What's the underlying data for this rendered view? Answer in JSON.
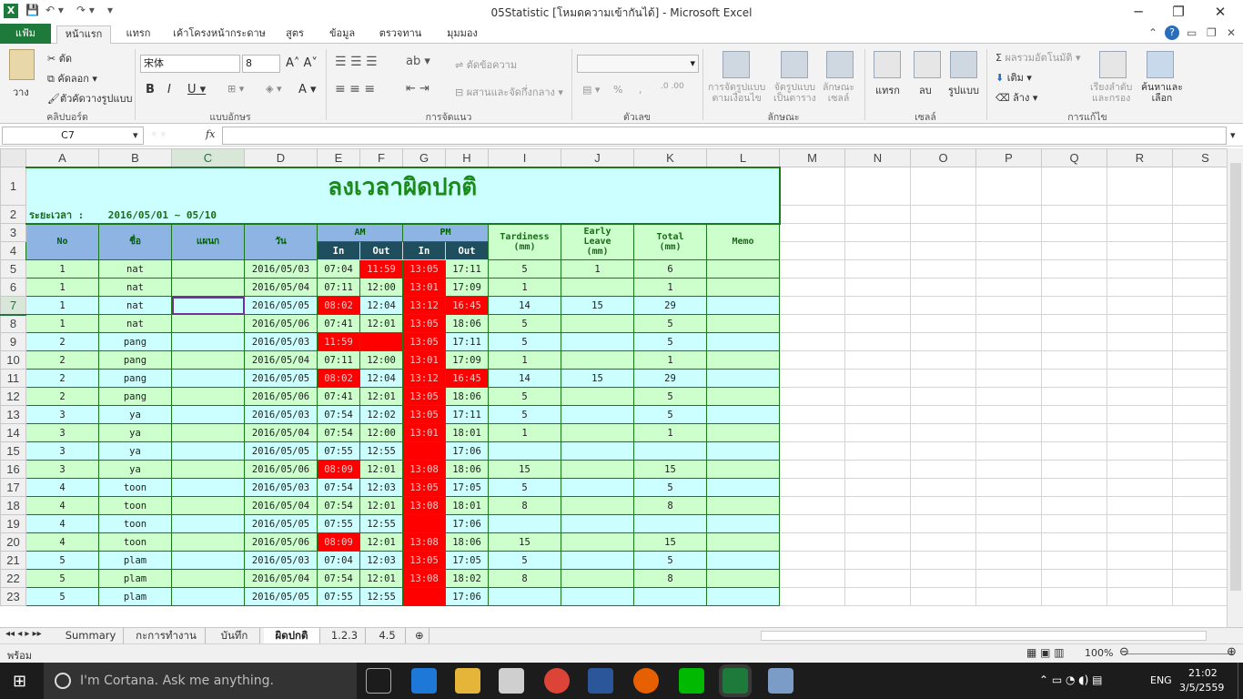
{
  "window": {
    "title": "05Statistic  [โหมดความเข้ากันได้] - Microsoft Excel"
  },
  "ribbon_tabs": [
    "แฟ้ม",
    "หน้าแรก",
    "แทรก",
    "เค้าโครงหน้ากระดาษ",
    "สูตร",
    "ข้อมูล",
    "ตรวจทาน",
    "มุมมอง"
  ],
  "ribbon": {
    "clipboard": {
      "cut": "ตัด",
      "copy": "คัดลอก",
      "paste": "วาง",
      "format_painter": "ตัวคัดวางรูปแบบ",
      "label": "คลิปบอร์ด"
    },
    "font": {
      "name": "宋体",
      "size": "8",
      "label": "แบบอักษร"
    },
    "alignment": {
      "wrap": "ตัดข้อความ",
      "merge": "ผสานและจัดกึ่งกลาง",
      "label": "การจัดแนว"
    },
    "number": {
      "percent": "%",
      "comma": ",",
      "label": "ตัวเลข"
    },
    "styles": {
      "conditional": "การจัดรูปแบบ\nตามเงื่อนไข",
      "format_table": "จัดรูปแบบ\nเป็นตาราง",
      "cell_styles": "ลักษณะ\nเซลล์",
      "label": "ลักษณะ"
    },
    "cells": {
      "insert": "แทรก",
      "delete": "ลบ",
      "format": "รูปแบบ",
      "label": "เซลล์"
    },
    "editing": {
      "autosum": "ผลรวมอัตโนมัติ",
      "fill": "เติม",
      "clear": "ล้าง",
      "sort": "เรียงลำดับ\nและกรอง",
      "find": "ค้นหาและ\nเลือก",
      "label": "การแก้ไข"
    }
  },
  "formula_bar": {
    "name_box": "C7",
    "fx": "fx",
    "value": ""
  },
  "columns": [
    "A",
    "B",
    "C",
    "D",
    "E",
    "F",
    "G",
    "H",
    "I",
    "J",
    "K",
    "L",
    "M",
    "N",
    "O",
    "P",
    "Q",
    "R",
    "S"
  ],
  "sheet": {
    "title": "ลงเวลาผิดปกติ",
    "period_label": "ระยะเวลา :",
    "period_value": "2016/05/01 ~ 05/10",
    "headers": {
      "no": "No",
      "name": "ชื่อ",
      "dept": "แผนก",
      "date": "วัน",
      "am": "AM",
      "pm": "PM",
      "in": "In",
      "out": "Out",
      "tardiness": "Tardiness\n(mm)",
      "early": "Early\nLeave\n(mm)",
      "total": "Total\n(mm)",
      "memo": "Memo"
    },
    "rows": [
      {
        "r": "5",
        "no": "1",
        "name": "nat",
        "date": "2016/05/03",
        "am_in": "07:04",
        "am_out": "11:59",
        "pm_in": "13:05",
        "pm_out": "17:11",
        "tard": "5",
        "early": "1",
        "total": "6",
        "red": [
          false,
          true,
          true,
          false
        ],
        "color": "green"
      },
      {
        "r": "6",
        "no": "1",
        "name": "nat",
        "date": "2016/05/04",
        "am_in": "07:11",
        "am_out": "12:00",
        "pm_in": "13:01",
        "pm_out": "17:09",
        "tard": "1",
        "early": "",
        "total": "1",
        "red": [
          false,
          false,
          true,
          false
        ],
        "color": "green"
      },
      {
        "r": "7",
        "no": "1",
        "name": "nat",
        "date": "2016/05/05",
        "am_in": "08:02",
        "am_out": "12:04",
        "pm_in": "13:12",
        "pm_out": "16:45",
        "tard": "14",
        "early": "15",
        "total": "29",
        "red": [
          true,
          false,
          true,
          true
        ],
        "color": "cyan"
      },
      {
        "r": "8",
        "no": "1",
        "name": "nat",
        "date": "2016/05/06",
        "am_in": "07:41",
        "am_out": "12:01",
        "pm_in": "13:05",
        "pm_out": "18:06",
        "tard": "5",
        "early": "",
        "total": "5",
        "red": [
          false,
          false,
          true,
          false
        ],
        "color": "green"
      },
      {
        "r": "9",
        "no": "2",
        "name": "pang",
        "date": "2016/05/03",
        "am_in": "11:59",
        "am_out": "",
        "pm_in": "13:05",
        "pm_out": "17:11",
        "tard": "5",
        "early": "",
        "total": "5",
        "red": [
          true,
          true,
          true,
          false
        ],
        "color": "cyan"
      },
      {
        "r": "10",
        "no": "2",
        "name": "pang",
        "date": "2016/05/04",
        "am_in": "07:11",
        "am_out": "12:00",
        "pm_in": "13:01",
        "pm_out": "17:09",
        "tard": "1",
        "early": "",
        "total": "1",
        "red": [
          false,
          false,
          true,
          false
        ],
        "color": "green"
      },
      {
        "r": "11",
        "no": "2",
        "name": "pang",
        "date": "2016/05/05",
        "am_in": "08:02",
        "am_out": "12:04",
        "pm_in": "13:12",
        "pm_out": "16:45",
        "tard": "14",
        "early": "15",
        "total": "29",
        "red": [
          true,
          false,
          true,
          true
        ],
        "color": "cyan"
      },
      {
        "r": "12",
        "no": "2",
        "name": "pang",
        "date": "2016/05/06",
        "am_in": "07:41",
        "am_out": "12:01",
        "pm_in": "13:05",
        "pm_out": "18:06",
        "tard": "5",
        "early": "",
        "total": "5",
        "red": [
          false,
          false,
          true,
          false
        ],
        "color": "green"
      },
      {
        "r": "13",
        "no": "3",
        "name": "ya",
        "date": "2016/05/03",
        "am_in": "07:54",
        "am_out": "12:02",
        "pm_in": "13:05",
        "pm_out": "17:11",
        "tard": "5",
        "early": "",
        "total": "5",
        "red": [
          false,
          false,
          true,
          false
        ],
        "color": "cyan"
      },
      {
        "r": "14",
        "no": "3",
        "name": "ya",
        "date": "2016/05/04",
        "am_in": "07:54",
        "am_out": "12:00",
        "pm_in": "13:01",
        "pm_out": "18:01",
        "tard": "1",
        "early": "",
        "total": "1",
        "red": [
          false,
          false,
          true,
          false
        ],
        "color": "green"
      },
      {
        "r": "15",
        "no": "3",
        "name": "ya",
        "date": "2016/05/05",
        "am_in": "07:55",
        "am_out": "12:55",
        "pm_in": "",
        "pm_out": "17:06",
        "tard": "",
        "early": "",
        "total": "",
        "red": [
          false,
          false,
          true,
          false
        ],
        "color": "cyan"
      },
      {
        "r": "16",
        "no": "3",
        "name": "ya",
        "date": "2016/05/06",
        "am_in": "08:09",
        "am_out": "12:01",
        "pm_in": "13:08",
        "pm_out": "18:06",
        "tard": "15",
        "early": "",
        "total": "15",
        "red": [
          true,
          false,
          true,
          false
        ],
        "color": "green"
      },
      {
        "r": "17",
        "no": "4",
        "name": "toon",
        "date": "2016/05/03",
        "am_in": "07:54",
        "am_out": "12:03",
        "pm_in": "13:05",
        "pm_out": "17:05",
        "tard": "5",
        "early": "",
        "total": "5",
        "red": [
          false,
          false,
          true,
          false
        ],
        "color": "cyan"
      },
      {
        "r": "18",
        "no": "4",
        "name": "toon",
        "date": "2016/05/04",
        "am_in": "07:54",
        "am_out": "12:01",
        "pm_in": "13:08",
        "pm_out": "18:01",
        "tard": "8",
        "early": "",
        "total": "8",
        "red": [
          false,
          false,
          true,
          false
        ],
        "color": "green"
      },
      {
        "r": "19",
        "no": "4",
        "name": "toon",
        "date": "2016/05/05",
        "am_in": "07:55",
        "am_out": "12:55",
        "pm_in": "",
        "pm_out": "17:06",
        "tard": "",
        "early": "",
        "total": "",
        "red": [
          false,
          false,
          true,
          false
        ],
        "color": "cyan"
      },
      {
        "r": "20",
        "no": "4",
        "name": "toon",
        "date": "2016/05/06",
        "am_in": "08:09",
        "am_out": "12:01",
        "pm_in": "13:08",
        "pm_out": "18:06",
        "tard": "15",
        "early": "",
        "total": "15",
        "red": [
          true,
          false,
          true,
          false
        ],
        "color": "green"
      },
      {
        "r": "21",
        "no": "5",
        "name": "plam",
        "date": "2016/05/03",
        "am_in": "07:04",
        "am_out": "12:03",
        "pm_in": "13:05",
        "pm_out": "17:05",
        "tard": "5",
        "early": "",
        "total": "5",
        "red": [
          false,
          false,
          true,
          false
        ],
        "color": "cyan"
      },
      {
        "r": "22",
        "no": "5",
        "name": "plam",
        "date": "2016/05/04",
        "am_in": "07:54",
        "am_out": "12:01",
        "pm_in": "13:08",
        "pm_out": "18:02",
        "tard": "8",
        "early": "",
        "total": "8",
        "red": [
          false,
          false,
          true,
          false
        ],
        "color": "green"
      },
      {
        "r": "23",
        "no": "5",
        "name": "plam",
        "date": "2016/05/05",
        "am_in": "07:55",
        "am_out": "12:55",
        "pm_in": "",
        "pm_out": "17:06",
        "tard": "",
        "early": "",
        "total": "",
        "red": [
          false,
          false,
          true,
          false
        ],
        "color": "cyan"
      }
    ]
  },
  "sheet_tabs": [
    "Summary",
    "กะการทำงาน",
    "บันทึก",
    "ผิดปกติ",
    "1.2.3",
    "4.5"
  ],
  "active_sheet": "ผิดปกติ",
  "status": {
    "ready": "พร้อม",
    "zoom": "100%"
  },
  "taskbar": {
    "search": "I'm Cortana. Ask me anything.",
    "lang": "ENG",
    "time": "21:02",
    "date": "3/5/2559"
  }
}
